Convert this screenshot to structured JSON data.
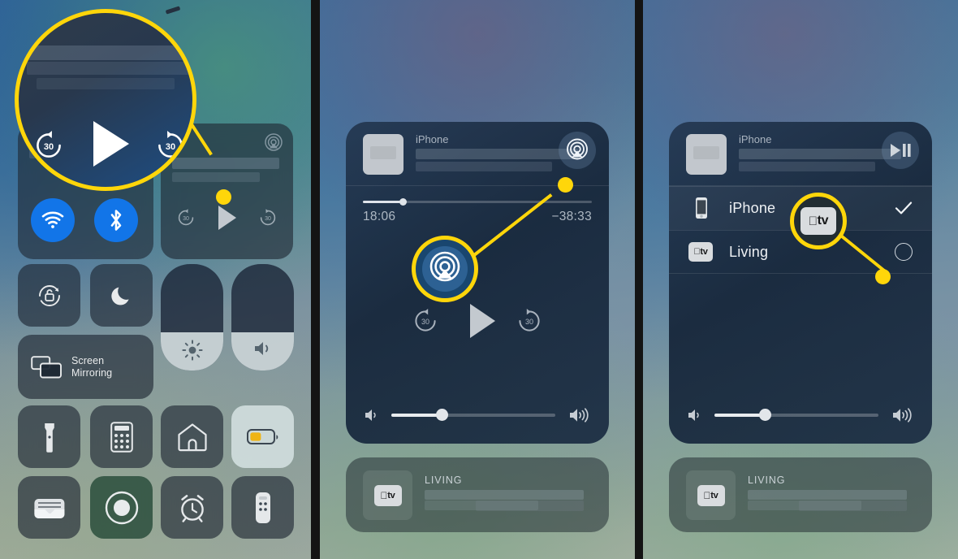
{
  "meta": {
    "accent_yellow": "#ffd60a",
    "accent_blue": "#1275e8",
    "panel_count": 3
  },
  "left_panel": {
    "name": "ios-control-center",
    "connectivity": {
      "wifi_icon": "wifi-icon",
      "bluetooth_icon": "bluetooth-icon",
      "wifi_state": "on",
      "bluetooth_state": "on"
    },
    "media_card": {
      "airplay_icon": "airplay-audio-icon",
      "rewind_label": "30",
      "forward_label": "30",
      "play_icon": "play-icon"
    },
    "tiles": [
      {
        "name": "rotation-lock-tile",
        "icon": "rotation-lock-icon",
        "label": ""
      },
      {
        "name": "do-not-disturb-tile",
        "icon": "moon-icon",
        "label": ""
      },
      {
        "name": "brightness-slider-tile",
        "icon": "brightness-icon",
        "fill_percent": 36
      },
      {
        "name": "volume-slider-tile",
        "icon": "speaker-icon",
        "fill_percent": 36
      },
      {
        "name": "screen-mirroring-tile",
        "icon": "screen-mirroring-icon",
        "label_line1": "Screen",
        "label_line2": "Mirroring"
      },
      {
        "name": "flashlight-tile",
        "icon": "flashlight-icon",
        "label": ""
      },
      {
        "name": "calculator-tile",
        "icon": "calculator-icon",
        "label": ""
      },
      {
        "name": "home-tile",
        "icon": "home-icon",
        "label": ""
      },
      {
        "name": "low-power-tile",
        "icon": "battery-icon",
        "label": ""
      },
      {
        "name": "wallet-tile",
        "icon": "wallet-icon",
        "label": ""
      },
      {
        "name": "screen-record-tile",
        "icon": "record-icon",
        "label": ""
      },
      {
        "name": "alarm-tile",
        "icon": "alarm-clock-icon",
        "label": ""
      },
      {
        "name": "apple-tv-remote-tile",
        "icon": "tv-remote-icon",
        "label": ""
      }
    ],
    "callout": {
      "magnifier_label": "magnified-media-controls",
      "rewind_label": "30",
      "forward_label": "30",
      "play_icon": "play-icon"
    }
  },
  "mid_panel": {
    "media_card": {
      "source_label": "iPhone",
      "artwork": "album-art-placeholder",
      "airplay_icon": "airplay-audio-icon",
      "elapsed": "18:06",
      "remaining": "−38:33",
      "progress_percent": 18,
      "rewind_label": "30",
      "forward_label": "30",
      "play_icon": "play-icon",
      "volume_percent": 30,
      "volume_min_icon": "speaker-low-icon",
      "volume_max_icon": "speaker-high-icon"
    },
    "living_card": {
      "label": "LIVING",
      "badge": "tv",
      "badge_icon": "apple-tv-icon"
    },
    "callout": {
      "target": "airplay-button",
      "magnified_icon": "airplay-audio-icon"
    }
  },
  "right_panel": {
    "media_card": {
      "source_label": "iPhone",
      "artwork": "album-art-placeholder",
      "playpause_icon": "play-pause-icon",
      "devices": [
        {
          "name": "iPhone",
          "icon": "iphone-icon",
          "selected": true,
          "control": "checkmark"
        },
        {
          "name": "Living",
          "icon": "apple-tv-icon",
          "badge": "tv",
          "selected": false,
          "control": "radio-empty"
        }
      ],
      "volume_percent": 30,
      "volume_min_icon": "speaker-low-icon",
      "volume_max_icon": "speaker-high-icon"
    },
    "living_card": {
      "label": "LIVING",
      "badge": "tv",
      "badge_icon": "apple-tv-icon"
    },
    "callout": {
      "target": "living-apple-tv-device",
      "magnified_badge": "tv",
      "magnified_icon": "apple-tv-icon"
    }
  }
}
